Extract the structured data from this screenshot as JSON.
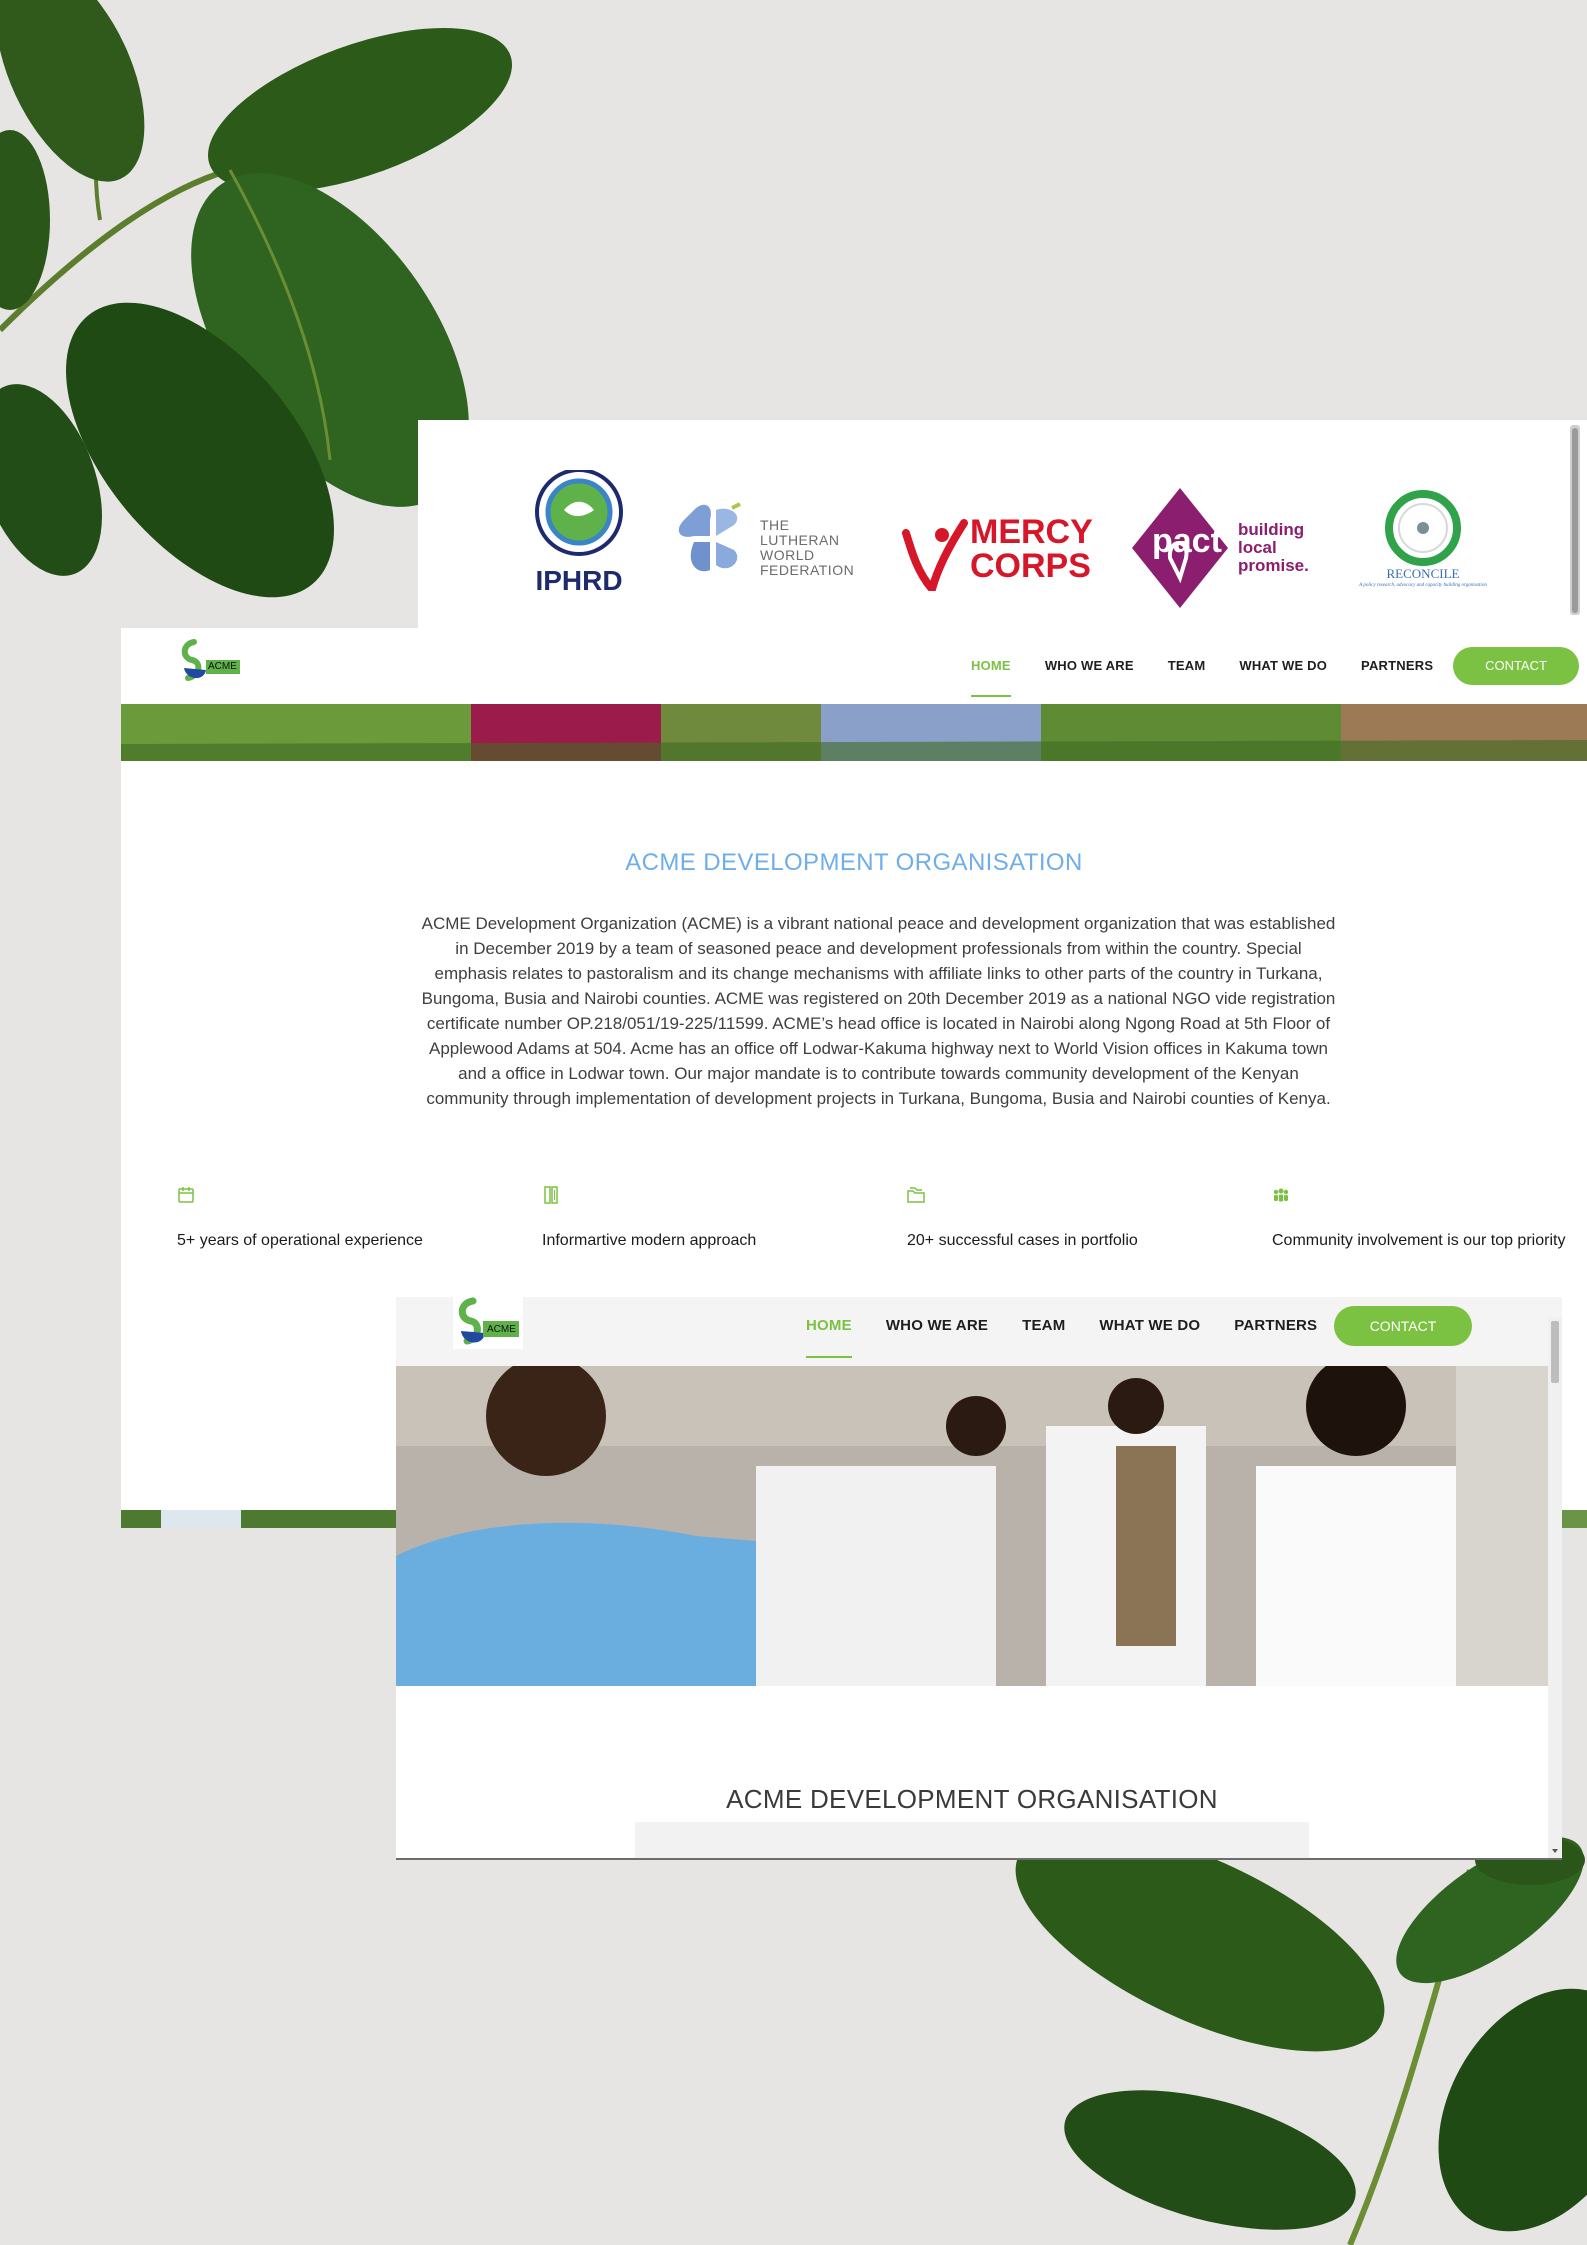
{
  "partners": {
    "logos": [
      {
        "name": "IPHRD",
        "label": "IPHRD"
      },
      {
        "name": "The Lutheran World Federation",
        "label": "THE LUTHERAN WORLD FEDERATION",
        "lines": [
          "THE",
          "LUTHERAN",
          "WORLD",
          "FEDERATION"
        ]
      },
      {
        "name": "Mercy Corps",
        "label": "MERCY CORPS",
        "lines": [
          "MERCY",
          "CORPS"
        ]
      },
      {
        "name": "Pact",
        "label": "pact",
        "tagline_lines": [
          "building",
          "local",
          "promise."
        ]
      },
      {
        "name": "Reconcile",
        "label": "RECONCILE",
        "tagline": "A policy research, advocacy and capacity building organisation"
      }
    ]
  },
  "site": {
    "logo_text": "ACME",
    "nav": {
      "items": [
        {
          "label": "HOME",
          "active": true
        },
        {
          "label": "WHO WE ARE",
          "active": false
        },
        {
          "label": "TEAM",
          "active": false
        },
        {
          "label": "WHAT WE DO",
          "active": false
        },
        {
          "label": "PARTNERS",
          "active": false
        }
      ],
      "contact_label": "CONTACT"
    },
    "title": "ACME DEVELOPMENT ORGANISATION",
    "description": "ACME Development Organization (ACME) is a vibrant national peace and development organization that was established in December 2019 by a team of seasoned peace and development professionals from within the country. Special emphasis relates to pastoralism and its change mechanisms with affiliate links to other parts of the country in Turkana, Bungoma, Busia and Nairobi counties. ACME was registered on 20th December 2019 as a national NGO vide registration certificate number OP.218/051/19-225/11599. ACME’s head office is located in Nairobi along Ngong Road at 5th Floor of Applewood Adams at 504. Acme has an office off Lodwar-Kakuma highway next to World Vision offices in Kakuma town and a office in Lodwar town. Our major mandate is to contribute towards community development of the Kenyan community through implementation of development projects in Turkana, Bungoma, Busia and Nairobi counties of Kenya.",
    "features": [
      {
        "icon": "calendar-icon",
        "text": "5+ years of operational experience"
      },
      {
        "icon": "tools-icon",
        "text": "Informartive modern approach"
      },
      {
        "icon": "folders-icon",
        "text": "20+ successful cases in portfolio"
      },
      {
        "icon": "people-icon",
        "text": "Community involvement is our top priority"
      }
    ]
  },
  "overlay": {
    "logo_text": "ACME",
    "nav": {
      "items": [
        {
          "label": "HOME",
          "active": true
        },
        {
          "label": "WHO WE ARE",
          "active": false
        },
        {
          "label": "TEAM",
          "active": false
        },
        {
          "label": "WHAT WE DO",
          "active": false
        },
        {
          "label": "PARTNERS",
          "active": false
        }
      ],
      "contact_label": "CONTACT"
    },
    "title": "ACME DEVELOPMENT ORGANISATION"
  },
  "colors": {
    "accent_green": "#7cc242",
    "title_blue": "#6faee8",
    "page_background": "#e6e5e4"
  }
}
